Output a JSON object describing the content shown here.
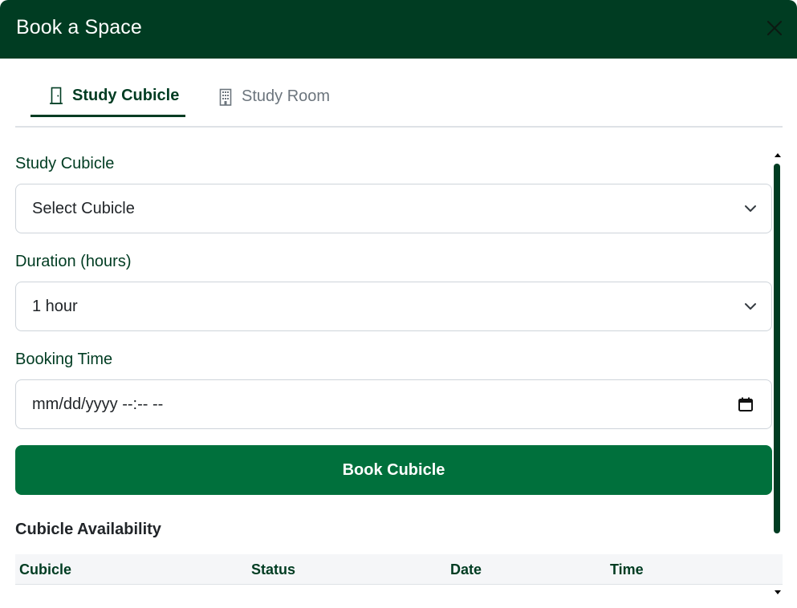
{
  "modal": {
    "title": "Book a Space",
    "close_icon": "close-icon"
  },
  "tabs": [
    {
      "label": "Study Cubicle",
      "icon": "door-icon",
      "active": true
    },
    {
      "label": "Study Room",
      "icon": "building-icon",
      "active": false
    }
  ],
  "form": {
    "cubicle_label": "Study Cubicle",
    "cubicle_value": "Select Cubicle",
    "duration_label": "Duration (hours)",
    "duration_value": "1 hour",
    "time_label": "Booking Time",
    "time_value": "mm/dd/yyyy --:-- --",
    "submit_label": "Book Cubicle"
  },
  "availability": {
    "title": "Cubicle Availability",
    "columns": [
      "Cubicle",
      "Status",
      "Date",
      "Time"
    ]
  },
  "colors": {
    "header_bg": "#003c22",
    "accent": "#003c22",
    "button_bg": "#00703c",
    "inactive_tab": "#6c757d"
  }
}
